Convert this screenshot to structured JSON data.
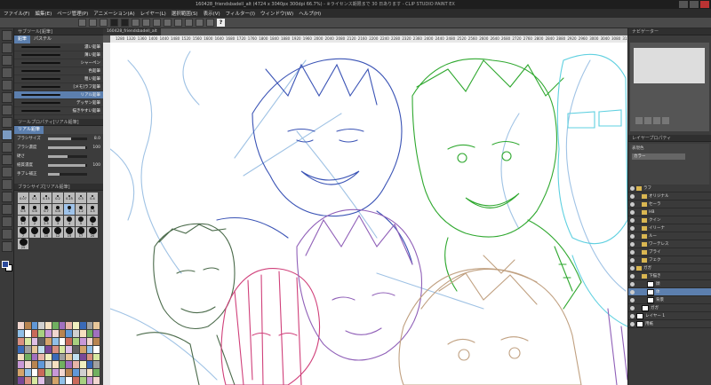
{
  "window": {
    "title": "160428_friendsbadell_alt (4724 x 3040px 300dpi 66.7%)",
    "title_suffix": "- ※ライセンス期限まで 30 日あります - CLIP STUDIO PAINT EX"
  },
  "menu": [
    "ファイル(F)",
    "編集(E)",
    "ページ管理(P)",
    "アニメーション(A)",
    "レイヤー(L)",
    "選択範囲(S)",
    "表示(V)",
    "フィルター(I)",
    "ウィンドウ(W)",
    "ヘルプ(H)"
  ],
  "toolbar": {
    "help_label": "?"
  },
  "left_panel": {
    "subtool_header": "サブツール[鉛筆]",
    "tabs": [
      "鉛筆",
      "パステル"
    ],
    "brushes": [
      {
        "label": "濃い鉛筆",
        "selected": false
      },
      {
        "label": "薄い鉛筆",
        "selected": false
      },
      {
        "label": "シャーペン",
        "selected": false
      },
      {
        "label": "色鉛筆",
        "selected": false
      },
      {
        "label": "粗い鉛筆",
        "selected": false
      },
      {
        "label": "[メモ]ラフ鉛筆",
        "selected": false
      },
      {
        "label": "リアル鉛筆",
        "selected": true
      },
      {
        "label": "デッサン鉛筆",
        "selected": false
      },
      {
        "label": "描きやすい鉛筆",
        "selected": false
      }
    ],
    "tool_property_header": "ツールプロパティ[リアル鉛筆]",
    "tool_property_tab": "リアル鉛筆",
    "properties": [
      {
        "label": "ブラシサイズ",
        "value": "8.0",
        "fill": 0.6
      },
      {
        "label": "ブラシ濃度",
        "value": "100",
        "fill": 0.95
      },
      {
        "label": "硬さ",
        "value": "",
        "fill": 0.5
      },
      {
        "label": "紙質濃度",
        "value": "100",
        "fill": 0.95
      },
      {
        "label": "手ブレ補正",
        "value": "",
        "fill": 0.3
      }
    ],
    "size_header": "ブラシサイズ[リアル鉛筆]",
    "sizes": [
      "0.07",
      "0.1",
      "0.15",
      "0.2",
      "0.25",
      "0.3",
      "0.4",
      "0.5",
      "0.6",
      "0.7",
      "0.8",
      "1",
      "1.2",
      "1.5",
      "1.7",
      "2",
      "2.5",
      "3",
      "4",
      "5",
      "6",
      "7",
      "8",
      "10",
      "12",
      "15",
      "17",
      "20",
      "25"
    ],
    "selected_size": "1"
  },
  "canvas": {
    "doc_tab": "160428_friendsbadell_alt",
    "ruler_ticks": [
      "1280",
      "1320",
      "1360",
      "1400",
      "1440",
      "1480",
      "1520",
      "1560",
      "1600",
      "1640",
      "1680",
      "1720",
      "1760",
      "1800",
      "1840",
      "1880",
      "1920",
      "1960",
      "2000",
      "2040",
      "2080",
      "2120",
      "2160",
      "2200",
      "2240",
      "2280",
      "2320",
      "2360",
      "2400",
      "2440",
      "2480",
      "2520",
      "2560",
      "2600",
      "2640",
      "2680",
      "2720",
      "2760",
      "2800",
      "2840",
      "2880",
      "2920",
      "2960",
      "3000",
      "3040",
      "3080",
      "3120"
    ]
  },
  "right_panel": {
    "navigator_header": "ナビゲーター",
    "layer_property_header": "レイヤープロパティ",
    "blend_label": "表現色",
    "blend_value": "カラー",
    "layers": [
      {
        "name": "ラフ",
        "type": "folder",
        "indent": 0,
        "selected": false
      },
      {
        "name": "オリジナル",
        "type": "folder",
        "indent": 1,
        "selected": false
      },
      {
        "name": "セーラ",
        "type": "folder",
        "indent": 1,
        "selected": false
      },
      {
        "name": "HB",
        "type": "folder",
        "indent": 1,
        "selected": false
      },
      {
        "name": "クイン",
        "type": "folder",
        "indent": 1,
        "selected": false
      },
      {
        "name": "イリーナ",
        "type": "folder",
        "indent": 1,
        "selected": false
      },
      {
        "name": "ルー",
        "type": "folder",
        "indent": 1,
        "selected": false
      },
      {
        "name": "ワーテレス",
        "type": "folder",
        "indent": 1,
        "selected": false
      },
      {
        "name": "ブライ",
        "type": "folder",
        "indent": 1,
        "selected": false
      },
      {
        "name": "フェク",
        "type": "folder",
        "indent": 1,
        "selected": false
      },
      {
        "name": "ガガ",
        "type": "folder",
        "indent": 0,
        "selected": false
      },
      {
        "name": "下描き",
        "type": "folder",
        "indent": 1,
        "selected": false
      },
      {
        "name": "顔",
        "type": "layer",
        "indent": 2,
        "selected": false
      },
      {
        "name": "体",
        "type": "layer",
        "indent": 2,
        "selected": true
      },
      {
        "name": "背景",
        "type": "layer",
        "indent": 2,
        "selected": false
      },
      {
        "name": "ガガ",
        "type": "layer",
        "indent": 1,
        "selected": false
      },
      {
        "name": "レイヤー 1",
        "type": "layer",
        "indent": 0,
        "selected": false
      },
      {
        "name": "用紙",
        "type": "layer",
        "indent": 0,
        "selected": false
      }
    ]
  },
  "colors": {
    "accent": "#5c7fae",
    "sketch_blue": "#3a53b5",
    "sketch_lightblue": "#8fb8e0",
    "sketch_green": "#2fa82f",
    "sketch_cyan": "#5fd0e0",
    "sketch_pink": "#d0407a",
    "sketch_purple": "#9060b8",
    "sketch_tan": "#c0a080",
    "sketch_darkgreen": "#4a6a4a"
  }
}
